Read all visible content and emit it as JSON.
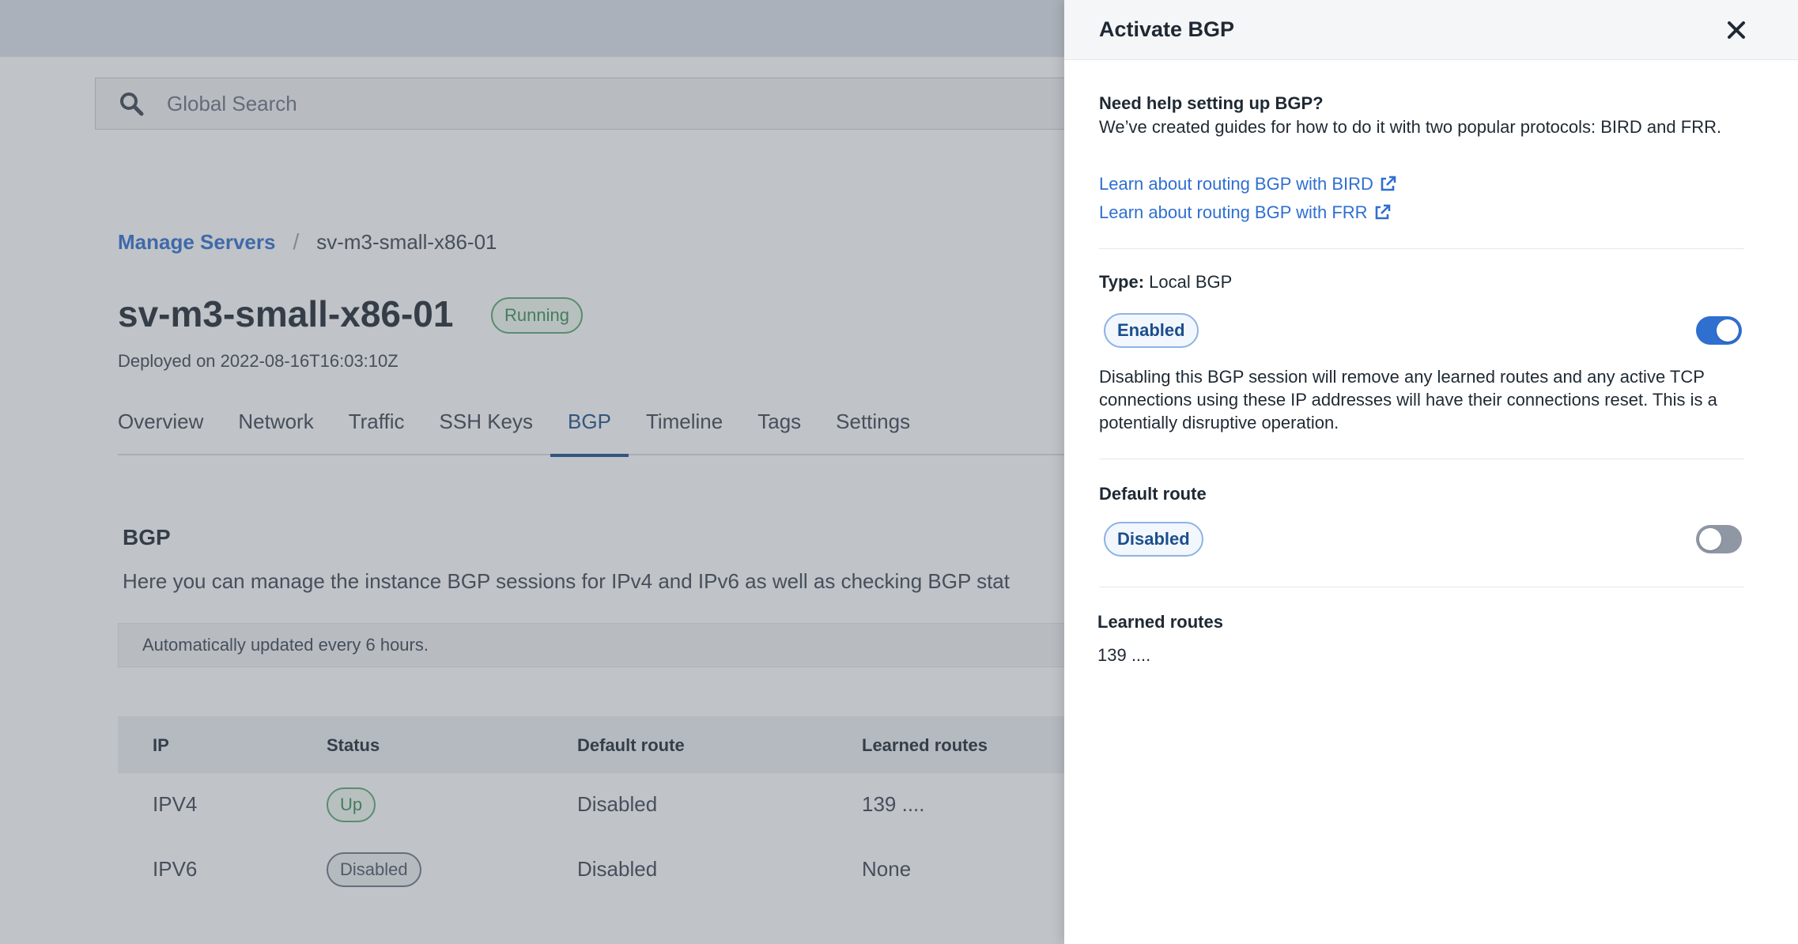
{
  "search": {
    "placeholder": "Global Search"
  },
  "breadcrumb": {
    "parent": "Manage Servers",
    "separator": "/",
    "current": "sv-m3-small-x86-01"
  },
  "server": {
    "name": "sv-m3-small-x86-01",
    "status": "Running",
    "deployed": "Deployed on 2022-08-16T16:03:10Z"
  },
  "tabs": [
    "Overview",
    "Network",
    "Traffic",
    "SSH Keys",
    "BGP",
    "Timeline",
    "Tags",
    "Settings"
  ],
  "active_tab": "BGP",
  "bgp": {
    "heading": "BGP",
    "description": "Here you can manage the instance BGP sessions for IPv4 and IPv6 as well as checking BGP stat",
    "notice": "Automatically updated every 6 hours.",
    "columns": [
      "IP",
      "Status",
      "Default route",
      "Learned routes"
    ],
    "rows": [
      {
        "ip": "IPV4",
        "status": "Up",
        "default_route": "Disabled",
        "learned_routes": "139 ...."
      },
      {
        "ip": "IPV6",
        "status": "Disabled",
        "default_route": "Disabled",
        "learned_routes": "None"
      }
    ]
  },
  "drawer": {
    "title": "Activate BGP",
    "close_icon": "close-icon",
    "help_title": "Need help setting up BGP?",
    "help_text": "We’ve created guides for how to do it with two popular protocols: BIRD and FRR.",
    "links": [
      "Learn about routing BGP with BIRD",
      "Learn about routing BGP with FRR"
    ],
    "type_label": "Type:",
    "type_value": "Local BGP",
    "session_status": "Enabled",
    "session_enabled": true,
    "warning": "Disabling this BGP session will remove any learned routes and any active TCP connections using these IP addresses will have their connections reset. This is a potentially disruptive operation.",
    "default_route_label": "Default route",
    "default_route_status": "Disabled",
    "default_route_enabled": false,
    "learned_routes_label": "Learned routes",
    "learned_routes_value": "139 ...."
  },
  "colors": {
    "accent": "#2f6fd0",
    "success": "#3a8d55",
    "toggle_off": "#8f97a4"
  }
}
